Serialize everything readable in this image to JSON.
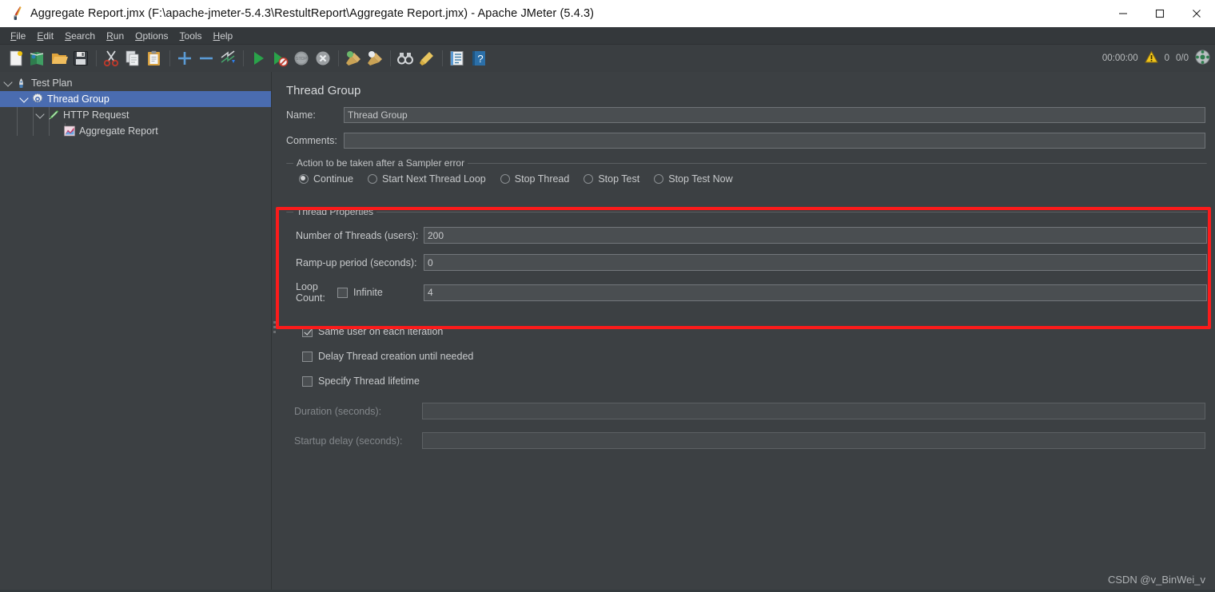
{
  "window": {
    "title": "Aggregate Report.jmx (F:\\apache-jmeter-5.4.3\\RestultReport\\Aggregate Report.jmx) - Apache JMeter (5.4.3)",
    "app_icon": "jmeter-feather-icon",
    "minimize_label": "—",
    "maximize_label": "☐",
    "close_label": "✕"
  },
  "menubar": {
    "items": [
      {
        "label": "File",
        "mnemonic": "F"
      },
      {
        "label": "Edit",
        "mnemonic": "E"
      },
      {
        "label": "Search",
        "mnemonic": "S"
      },
      {
        "label": "Run",
        "mnemonic": "R"
      },
      {
        "label": "Options",
        "mnemonic": "O"
      },
      {
        "label": "Tools",
        "mnemonic": "T"
      },
      {
        "label": "Help",
        "mnemonic": "H"
      }
    ]
  },
  "toolbar": {
    "buttons": [
      {
        "name": "new-icon",
        "tooltip": "New"
      },
      {
        "name": "templates-icon",
        "tooltip": "Templates"
      },
      {
        "name": "open-icon",
        "tooltip": "Open"
      },
      {
        "name": "save-icon",
        "tooltip": "Save Test Plan"
      },
      {
        "name": "cut-icon",
        "tooltip": "Cut"
      },
      {
        "name": "copy-icon",
        "tooltip": "Copy"
      },
      {
        "name": "paste-icon",
        "tooltip": "Paste"
      },
      {
        "name": "expand-all-icon",
        "tooltip": "Expand All"
      },
      {
        "name": "collapse-all-icon",
        "tooltip": "Collapse All"
      },
      {
        "name": "toggle-icon",
        "tooltip": "Toggle"
      },
      {
        "name": "start-icon",
        "tooltip": "Start"
      },
      {
        "name": "start-no-pauses-icon",
        "tooltip": "Start no pauses"
      },
      {
        "name": "stop-icon",
        "tooltip": "Stop"
      },
      {
        "name": "shutdown-icon",
        "tooltip": "Shutdown"
      },
      {
        "name": "clear-icon",
        "tooltip": "Clear"
      },
      {
        "name": "clear-all-icon",
        "tooltip": "Clear All"
      },
      {
        "name": "search-icon",
        "tooltip": "Search"
      },
      {
        "name": "search-reset-icon",
        "tooltip": "Reset Search"
      },
      {
        "name": "function-helper-icon",
        "tooltip": "Function Helper Dialog"
      },
      {
        "name": "help-icon",
        "tooltip": "Help"
      }
    ],
    "status": {
      "elapsed": "00:00:00",
      "warning_icon": "warning-triangle-icon",
      "error_count": "0",
      "threads": "0/0",
      "remote_icon": "remote-engines-icon"
    }
  },
  "tree": {
    "nodes": [
      {
        "label": "Test Plan",
        "icon": "test-plan-icon",
        "depth": 0,
        "expanded": true,
        "selected": false
      },
      {
        "label": "Thread Group",
        "icon": "thread-group-gear-icon",
        "depth": 1,
        "expanded": true,
        "selected": true
      },
      {
        "label": "HTTP Request",
        "icon": "http-request-icon",
        "depth": 2,
        "expanded": true,
        "selected": false
      },
      {
        "label": "Aggregate Report",
        "icon": "aggregate-report-icon",
        "depth": 3,
        "expanded": false,
        "selected": false
      }
    ]
  },
  "editor": {
    "title": "Thread Group",
    "name_label": "Name:",
    "name_value": "Thread Group",
    "comments_label": "Comments:",
    "comments_value": "",
    "comments_placeholder": "",
    "sampler_error": {
      "group_title": "Action to be taken after a Sampler error",
      "options": [
        {
          "label": "Continue",
          "selected": true
        },
        {
          "label": "Start Next Thread Loop",
          "selected": false
        },
        {
          "label": "Stop Thread",
          "selected": false
        },
        {
          "label": "Stop Test",
          "selected": false
        },
        {
          "label": "Stop Test Now",
          "selected": false
        }
      ]
    },
    "thread_properties": {
      "group_title": "Thread Properties",
      "num_threads_label": "Number of Threads (users):",
      "num_threads_value": "200",
      "rampup_label": "Ramp-up period (seconds):",
      "rampup_value": "0",
      "loop_count_label": "Loop Count:",
      "infinite_label": "Infinite",
      "infinite_checked": false,
      "loop_count_value": "4"
    },
    "checkboxes": [
      {
        "label": "Same user on each iteration",
        "checked": true
      },
      {
        "label": "Delay Thread creation until needed",
        "checked": false
      },
      {
        "label": "Specify Thread lifetime",
        "checked": false
      }
    ],
    "duration_label": "Duration (seconds):",
    "duration_value": "",
    "startup_delay_label": "Startup delay (seconds):",
    "startup_delay_value": ""
  },
  "annotation": {
    "highlight_color": "#fb1b1b",
    "target": "thread-properties-group"
  },
  "watermark": "CSDN @v_BinWei_v"
}
